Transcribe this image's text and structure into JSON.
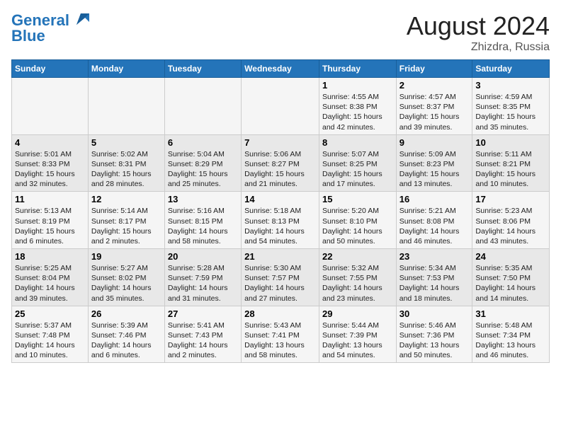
{
  "header": {
    "logo_line1": "General",
    "logo_line2": "Blue",
    "title": "August 2024",
    "subtitle": "Zhizdra, Russia"
  },
  "weekdays": [
    "Sunday",
    "Monday",
    "Tuesday",
    "Wednesday",
    "Thursday",
    "Friday",
    "Saturday"
  ],
  "weeks": [
    [
      {
        "day": "",
        "info": ""
      },
      {
        "day": "",
        "info": ""
      },
      {
        "day": "",
        "info": ""
      },
      {
        "day": "",
        "info": ""
      },
      {
        "day": "1",
        "info": "Sunrise: 4:55 AM\nSunset: 8:38 PM\nDaylight: 15 hours\nand 42 minutes."
      },
      {
        "day": "2",
        "info": "Sunrise: 4:57 AM\nSunset: 8:37 PM\nDaylight: 15 hours\nand 39 minutes."
      },
      {
        "day": "3",
        "info": "Sunrise: 4:59 AM\nSunset: 8:35 PM\nDaylight: 15 hours\nand 35 minutes."
      }
    ],
    [
      {
        "day": "4",
        "info": "Sunrise: 5:01 AM\nSunset: 8:33 PM\nDaylight: 15 hours\nand 32 minutes."
      },
      {
        "day": "5",
        "info": "Sunrise: 5:02 AM\nSunset: 8:31 PM\nDaylight: 15 hours\nand 28 minutes."
      },
      {
        "day": "6",
        "info": "Sunrise: 5:04 AM\nSunset: 8:29 PM\nDaylight: 15 hours\nand 25 minutes."
      },
      {
        "day": "7",
        "info": "Sunrise: 5:06 AM\nSunset: 8:27 PM\nDaylight: 15 hours\nand 21 minutes."
      },
      {
        "day": "8",
        "info": "Sunrise: 5:07 AM\nSunset: 8:25 PM\nDaylight: 15 hours\nand 17 minutes."
      },
      {
        "day": "9",
        "info": "Sunrise: 5:09 AM\nSunset: 8:23 PM\nDaylight: 15 hours\nand 13 minutes."
      },
      {
        "day": "10",
        "info": "Sunrise: 5:11 AM\nSunset: 8:21 PM\nDaylight: 15 hours\nand 10 minutes."
      }
    ],
    [
      {
        "day": "11",
        "info": "Sunrise: 5:13 AM\nSunset: 8:19 PM\nDaylight: 15 hours\nand 6 minutes."
      },
      {
        "day": "12",
        "info": "Sunrise: 5:14 AM\nSunset: 8:17 PM\nDaylight: 15 hours\nand 2 minutes."
      },
      {
        "day": "13",
        "info": "Sunrise: 5:16 AM\nSunset: 8:15 PM\nDaylight: 14 hours\nand 58 minutes."
      },
      {
        "day": "14",
        "info": "Sunrise: 5:18 AM\nSunset: 8:13 PM\nDaylight: 14 hours\nand 54 minutes."
      },
      {
        "day": "15",
        "info": "Sunrise: 5:20 AM\nSunset: 8:10 PM\nDaylight: 14 hours\nand 50 minutes."
      },
      {
        "day": "16",
        "info": "Sunrise: 5:21 AM\nSunset: 8:08 PM\nDaylight: 14 hours\nand 46 minutes."
      },
      {
        "day": "17",
        "info": "Sunrise: 5:23 AM\nSunset: 8:06 PM\nDaylight: 14 hours\nand 43 minutes."
      }
    ],
    [
      {
        "day": "18",
        "info": "Sunrise: 5:25 AM\nSunset: 8:04 PM\nDaylight: 14 hours\nand 39 minutes."
      },
      {
        "day": "19",
        "info": "Sunrise: 5:27 AM\nSunset: 8:02 PM\nDaylight: 14 hours\nand 35 minutes."
      },
      {
        "day": "20",
        "info": "Sunrise: 5:28 AM\nSunset: 7:59 PM\nDaylight: 14 hours\nand 31 minutes."
      },
      {
        "day": "21",
        "info": "Sunrise: 5:30 AM\nSunset: 7:57 PM\nDaylight: 14 hours\nand 27 minutes."
      },
      {
        "day": "22",
        "info": "Sunrise: 5:32 AM\nSunset: 7:55 PM\nDaylight: 14 hours\nand 23 minutes."
      },
      {
        "day": "23",
        "info": "Sunrise: 5:34 AM\nSunset: 7:53 PM\nDaylight: 14 hours\nand 18 minutes."
      },
      {
        "day": "24",
        "info": "Sunrise: 5:35 AM\nSunset: 7:50 PM\nDaylight: 14 hours\nand 14 minutes."
      }
    ],
    [
      {
        "day": "25",
        "info": "Sunrise: 5:37 AM\nSunset: 7:48 PM\nDaylight: 14 hours\nand 10 minutes."
      },
      {
        "day": "26",
        "info": "Sunrise: 5:39 AM\nSunset: 7:46 PM\nDaylight: 14 hours\nand 6 minutes."
      },
      {
        "day": "27",
        "info": "Sunrise: 5:41 AM\nSunset: 7:43 PM\nDaylight: 14 hours\nand 2 minutes."
      },
      {
        "day": "28",
        "info": "Sunrise: 5:43 AM\nSunset: 7:41 PM\nDaylight: 13 hours\nand 58 minutes."
      },
      {
        "day": "29",
        "info": "Sunrise: 5:44 AM\nSunset: 7:39 PM\nDaylight: 13 hours\nand 54 minutes."
      },
      {
        "day": "30",
        "info": "Sunrise: 5:46 AM\nSunset: 7:36 PM\nDaylight: 13 hours\nand 50 minutes."
      },
      {
        "day": "31",
        "info": "Sunrise: 5:48 AM\nSunset: 7:34 PM\nDaylight: 13 hours\nand 46 minutes."
      }
    ]
  ]
}
